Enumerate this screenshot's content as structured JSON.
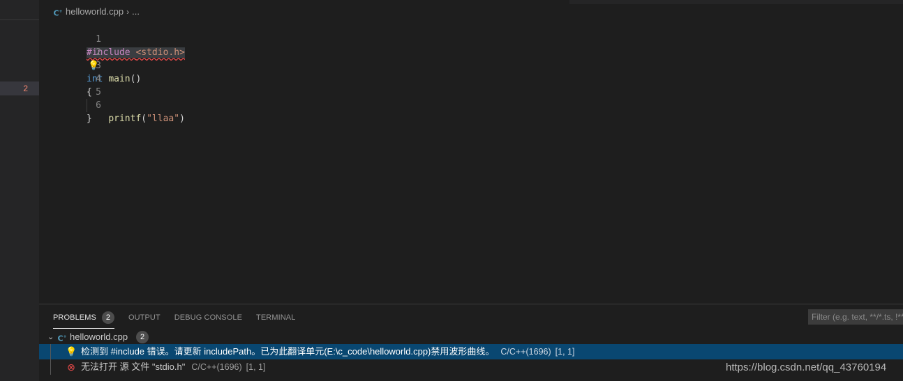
{
  "sidebar": {
    "problem_badge": "2"
  },
  "breadcrumb": {
    "file": "helloworld.cpp",
    "more": "..."
  },
  "editor": {
    "lines": [
      {
        "num": "1",
        "text": "#include <stdio.h>"
      },
      {
        "num": "2",
        "text": ""
      },
      {
        "num": "3",
        "text": "int main()"
      },
      {
        "num": "4",
        "text": "{"
      },
      {
        "num": "5",
        "text": "    printf(\"llaa\")"
      },
      {
        "num": "6",
        "text": "}"
      }
    ],
    "tokens": {
      "include": "#include",
      "header": "<stdio.h>",
      "int": "int",
      "main": "main",
      "parens": "()",
      "open_brace": "{",
      "printf": "printf",
      "str": "\"llaa\"",
      "close_paren": ")",
      "close_brace": "}"
    }
  },
  "panel": {
    "tabs": [
      {
        "label": "PROBLEMS",
        "count": "2",
        "active": true
      },
      {
        "label": "OUTPUT"
      },
      {
        "label": "DEBUG CONSOLE"
      },
      {
        "label": "TERMINAL"
      }
    ],
    "filter_placeholder": "Filter (e.g. text, **/*.ts, !**",
    "file": {
      "name": "helloworld.cpp",
      "count": "2"
    },
    "problems": [
      {
        "icon": "lightbulb-icon",
        "message": "检测到 #include 错误。请更新 includePath。已为此翻译单元(E:\\c_code\\helloworld.cpp)禁用波形曲线。",
        "source": "C/C++(1696)",
        "position": "[1, 1]"
      },
      {
        "icon": "error-icon",
        "message": "无法打开 源 文件 \"stdio.h\"",
        "source": "C/C++(1696)",
        "position": "[1, 1]"
      }
    ]
  },
  "watermark": "https://blog.csdn.net/qq_43760194",
  "colors": {
    "selection": "#094771",
    "error": "#f14c4c",
    "background": "#1e1e1e"
  }
}
